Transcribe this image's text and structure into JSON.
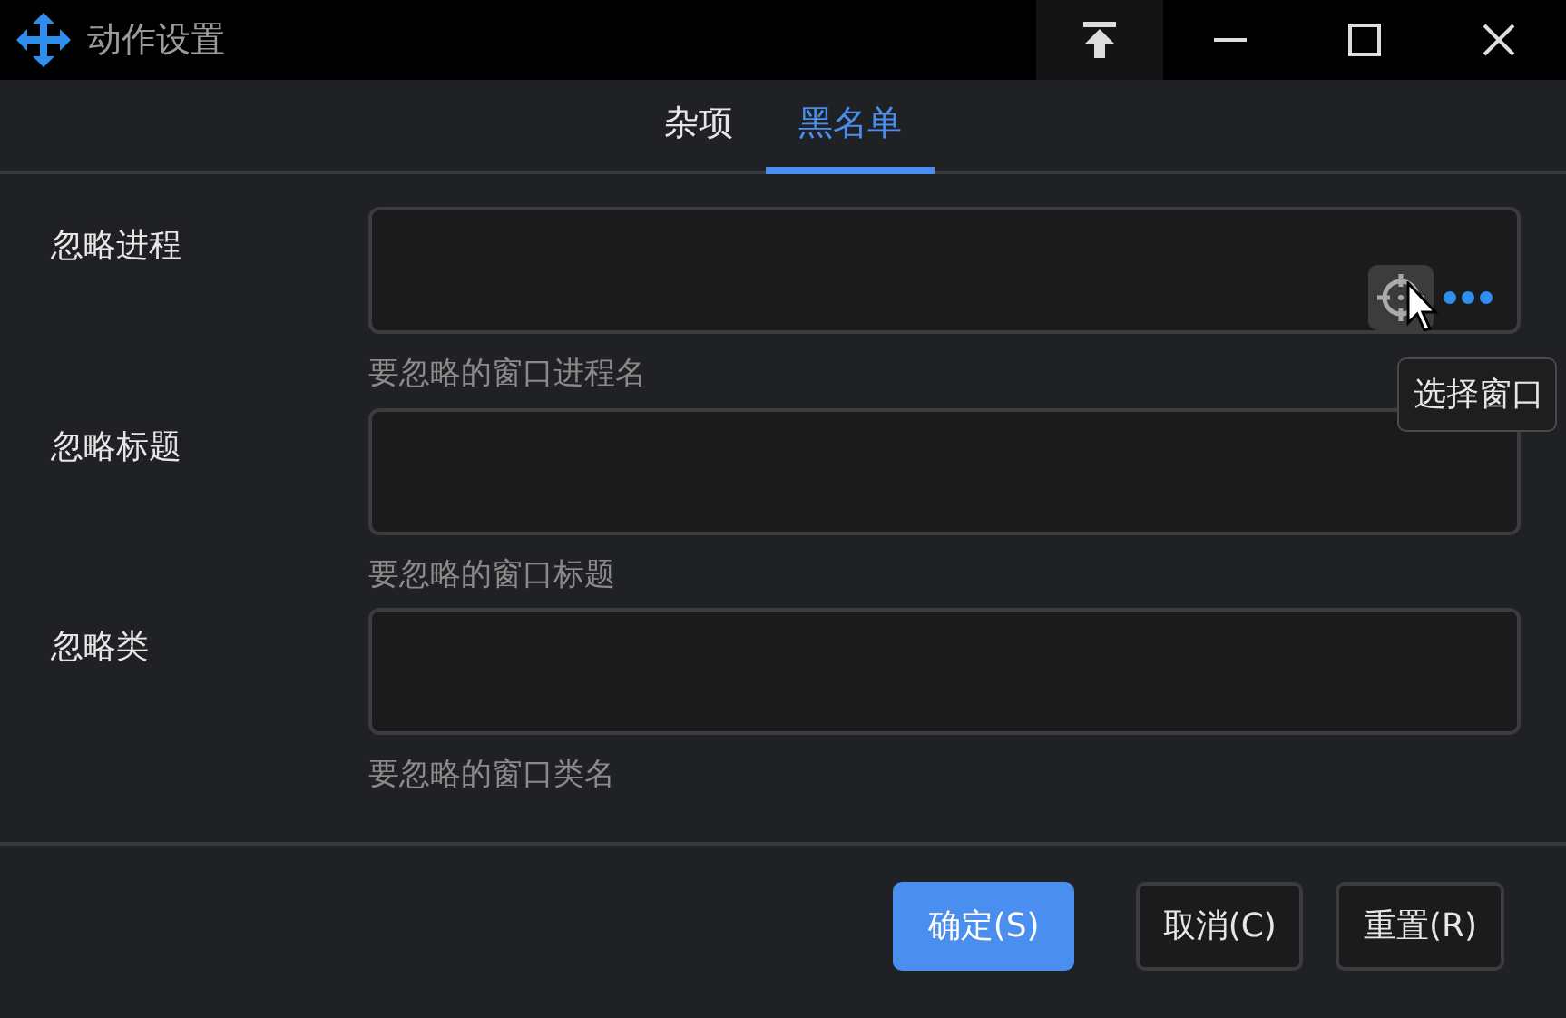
{
  "window": {
    "title": "动作设置"
  },
  "tabs": [
    {
      "label": "杂项",
      "selected": false
    },
    {
      "label": "黑名单",
      "selected": true
    }
  ],
  "fields": [
    {
      "label": "忽略进程",
      "hint": "要忽略的窗口进程名",
      "picker": true
    },
    {
      "label": "忽略标题",
      "hint": "要忽略的窗口标题",
      "picker": false
    },
    {
      "label": "忽略类",
      "hint": "要忽略的窗口类名",
      "picker": false
    }
  ],
  "tooltip": "选择窗口",
  "buttons": [
    {
      "label": "确定(S)",
      "primary": true
    },
    {
      "label": "取消(C)",
      "primary": false
    },
    {
      "label": "重置(R)",
      "primary": false
    }
  ]
}
